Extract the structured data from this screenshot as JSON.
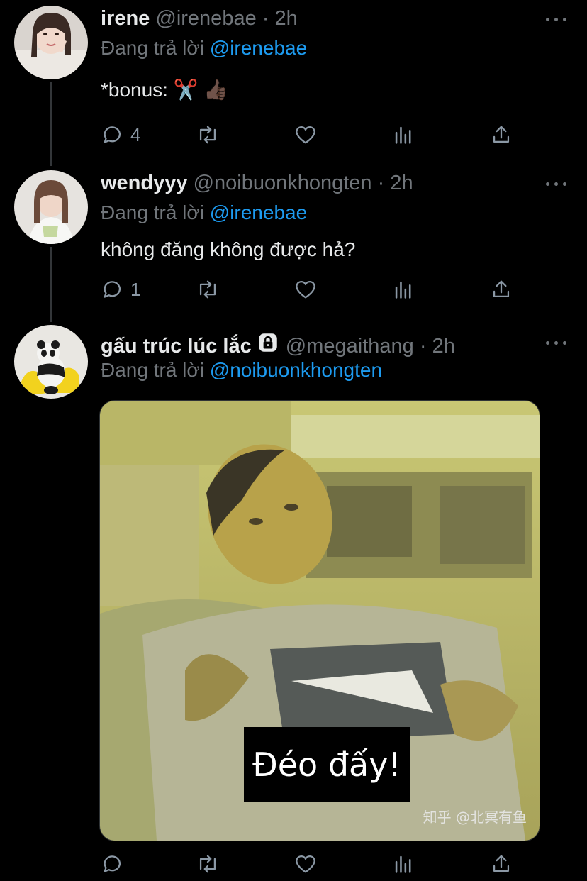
{
  "colors": {
    "background": "#000000",
    "accent": "#1d9bf0",
    "muted": "#71767b",
    "text": "#e7e9ea"
  },
  "tweets": [
    {
      "display_name": "irene",
      "handle": "@irenebae",
      "time": "2h",
      "reply_prefix": "Đang trả lời",
      "reply_to": "@irenebae",
      "text": "*bonus: ✂️ 👍🏿",
      "actions": {
        "reply_count": "4",
        "retweet_count": "",
        "like_count": ""
      },
      "icons": [
        "reply-icon",
        "retweet-icon",
        "like-icon",
        "analytics-icon",
        "share-icon"
      ]
    },
    {
      "display_name": "wendyyy",
      "handle": "@noibuonkhongten",
      "time": "2h",
      "reply_prefix": "Đang trả lời",
      "reply_to": "@irenebae",
      "text": "không đăng không được hả?",
      "actions": {
        "reply_count": "1",
        "retweet_count": "",
        "like_count": ""
      }
    },
    {
      "display_name": "gấu trúc lúc lắc",
      "handle": "@megaithang",
      "time": "2h",
      "reply_prefix": "Đang trả lời",
      "reply_to": "@noibuonkhongten",
      "media_caption": "Đéo đấy!",
      "media_watermark": "知乎 @北冥有鱼",
      "actions": {
        "reply_count": "",
        "retweet_count": "",
        "like_count": ""
      }
    }
  ],
  "separator": "·"
}
